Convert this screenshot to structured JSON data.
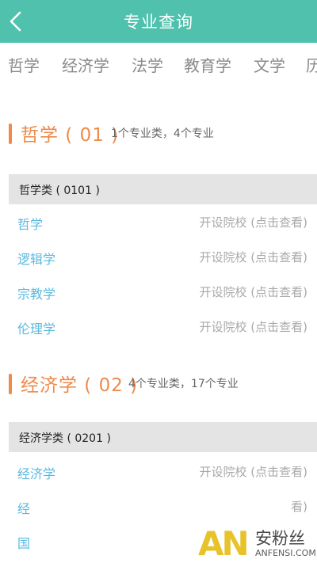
{
  "header": {
    "title": "专业查询",
    "back_icon": "chevron-left-icon"
  },
  "tabs": [
    "哲学",
    "经济学",
    "法学",
    "教育学",
    "文学",
    "历"
  ],
  "sections": [
    {
      "title": "哲学 ( 01 )",
      "subtitle": "1个专业类，4个专业",
      "category": "哲学类 ( 0101 )",
      "majors": [
        {
          "name": "哲学",
          "link": "开设院校 (点击查看)"
        },
        {
          "name": "逻辑学",
          "link": "开设院校 (点击查看)"
        },
        {
          "name": "宗教学",
          "link": "开设院校 (点击查看)"
        },
        {
          "name": "伦理学",
          "link": "开设院校 (点击查看)"
        }
      ]
    },
    {
      "title": "经济学 ( 02 )",
      "subtitle": "4个专业类，17个专业",
      "category": "经济学类 ( 0201 )",
      "majors": [
        {
          "name": "经济学",
          "link": "开设院校 (点击查看)"
        },
        {
          "name": "经",
          "link": "看)"
        },
        {
          "name": "国",
          "link": ""
        }
      ]
    }
  ],
  "watermark": {
    "logo": "AN",
    "cn": "安粉丝",
    "en": "ANFENSI.COM"
  },
  "colors": {
    "header": "#4fc1ad",
    "accent": "#ee8a4a",
    "link": "#5cb9de"
  }
}
